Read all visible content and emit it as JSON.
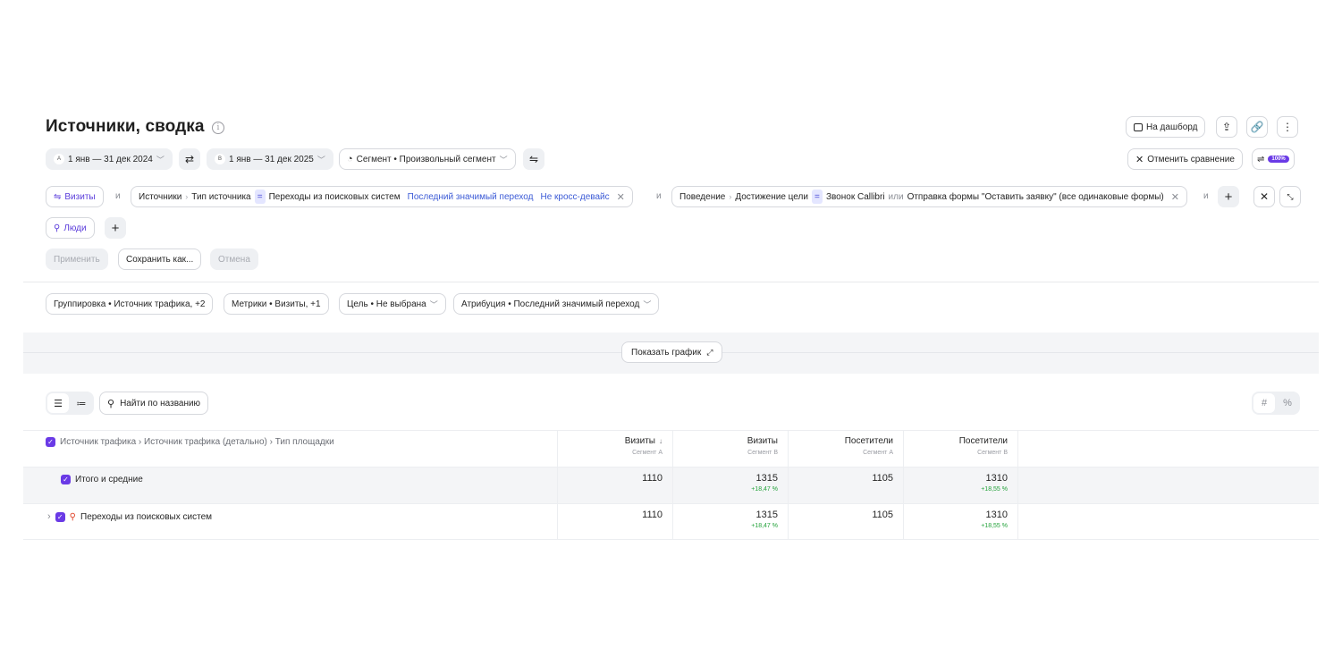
{
  "header": {
    "title": "Источники, сводка",
    "info_icon": "ⓘ",
    "dashboard_label": "На дашборд",
    "cancel_compare_label": "Отменить сравнение",
    "percent_badge": "100%"
  },
  "comparison": {
    "period_a_letter": "A",
    "period_a": "1 янв — 31 дек 2024",
    "period_b_letter": "B",
    "period_b": "1 янв — 31 дек 2025",
    "segment_label": "Сегмент • Произвольный сегмент"
  },
  "filters": {
    "visits_label": "Визиты",
    "and_label": "и",
    "filter1": {
      "group": "Источники",
      "field": "Тип источника",
      "eq": "=",
      "value": "Переходы из поисковых систем",
      "attribution": "Последний значимый переход",
      "device": "Не кросс-девайс"
    },
    "filter2": {
      "group": "Поведение",
      "field": "Достижение цели",
      "eq": "=",
      "value1": "Звонок Callibri",
      "or_label": "или",
      "value2": "Отправка формы \"Оставить заявку\" (все одинаковые формы)"
    },
    "people_label": "Люди"
  },
  "actions": {
    "apply": "Применить",
    "save_as": "Сохранить как...",
    "cancel": "Отмена"
  },
  "settings": {
    "grouping": "Группировка • Источник трафика, +2",
    "metrics": "Метрики • Визиты, +1",
    "goal": "Цель • Не выбрана",
    "attribution": "Атрибуция • Последний значимый переход"
  },
  "chart_toggle": {
    "label": "Показать график"
  },
  "toolbar": {
    "search_label": "Найти по названию",
    "hash": "#",
    "percent": "%"
  },
  "table": {
    "dimension_header": "Источник трафика › Источник трафика (детально) › Тип площадки",
    "columns": [
      {
        "label": "Визиты",
        "sub": "Сегмент A",
        "sorted": "↓"
      },
      {
        "label": "Визиты",
        "sub": "Сегмент B"
      },
      {
        "label": "Посетители",
        "sub": "Сегмент A"
      },
      {
        "label": "Посетители",
        "sub": "Сегмент B"
      }
    ],
    "total": {
      "label": "Итого и средние",
      "values": [
        "1110",
        "1315",
        "1105",
        "1310"
      ],
      "deltas": [
        "",
        "+18,47 %",
        "",
        "+18,55 %"
      ]
    },
    "rows": [
      {
        "label": "Переходы из поисковых систем",
        "values": [
          "1110",
          "1315",
          "1105",
          "1310"
        ],
        "deltas": [
          "",
          "+18,47 %",
          "",
          "+18,55 %"
        ]
      }
    ]
  },
  "colors": {
    "accent": "#6a3ae6",
    "positive": "#23a23a",
    "link": "#3c5bd6"
  }
}
